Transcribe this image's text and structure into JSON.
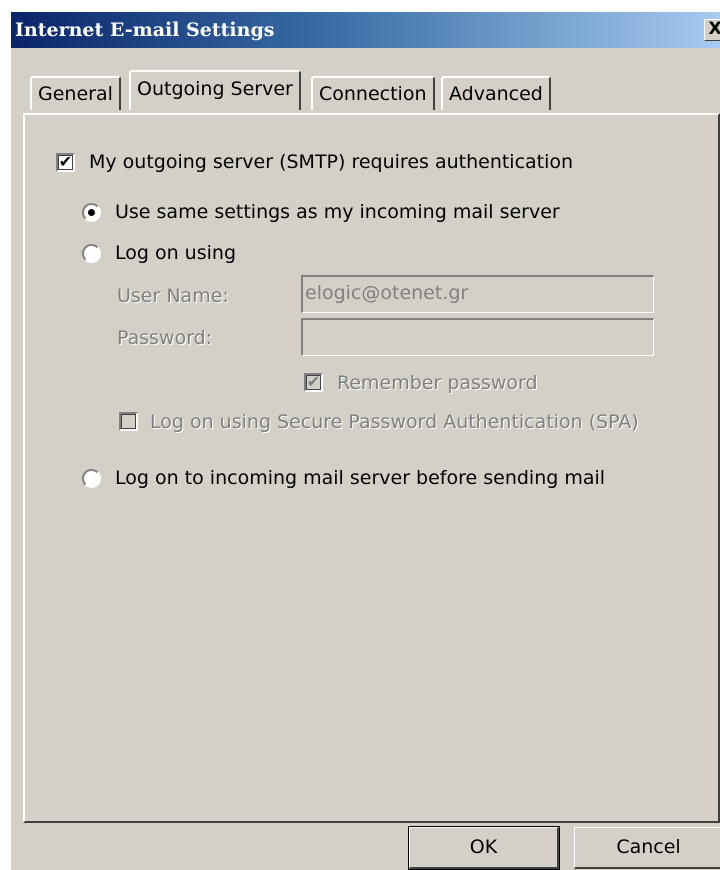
{
  "window": {
    "title": "Internet E-mail Settings",
    "close_glyph": "X"
  },
  "tabs": [
    {
      "label": "General",
      "active": false
    },
    {
      "label": "Outgoing Server",
      "active": true
    },
    {
      "label": "Connection",
      "active": false
    },
    {
      "label": "Advanced",
      "active": false
    }
  ],
  "outgoing": {
    "requires_auth": {
      "label": "My outgoing server (SMTP) requires authentication",
      "checked": true
    },
    "use_same": {
      "label": "Use same settings as my incoming mail server",
      "selected": true
    },
    "log_on_using": {
      "label": "Log on using",
      "selected": false
    },
    "user_name": {
      "label": "User Name:",
      "value": "elogic@otenet.gr"
    },
    "password": {
      "label": "Password:",
      "value": ""
    },
    "remember_password": {
      "label": "Remember password",
      "checked": true
    },
    "spa": {
      "label": "Log on using Secure Password Authentication (SPA)",
      "checked": false
    },
    "log_on_incoming": {
      "label": "Log on to incoming mail server before sending mail",
      "selected": false
    }
  },
  "buttons": {
    "ok": "OK",
    "cancel": "Cancel"
  },
  "colors": {
    "face": "#d4d0c8",
    "title_start": "#0a246a",
    "title_end": "#a6caf0",
    "disabled_text": "#808080"
  },
  "icons": {
    "check": "check-mark-icon",
    "radio_dot": "radio-dot-icon",
    "close": "close-icon"
  }
}
